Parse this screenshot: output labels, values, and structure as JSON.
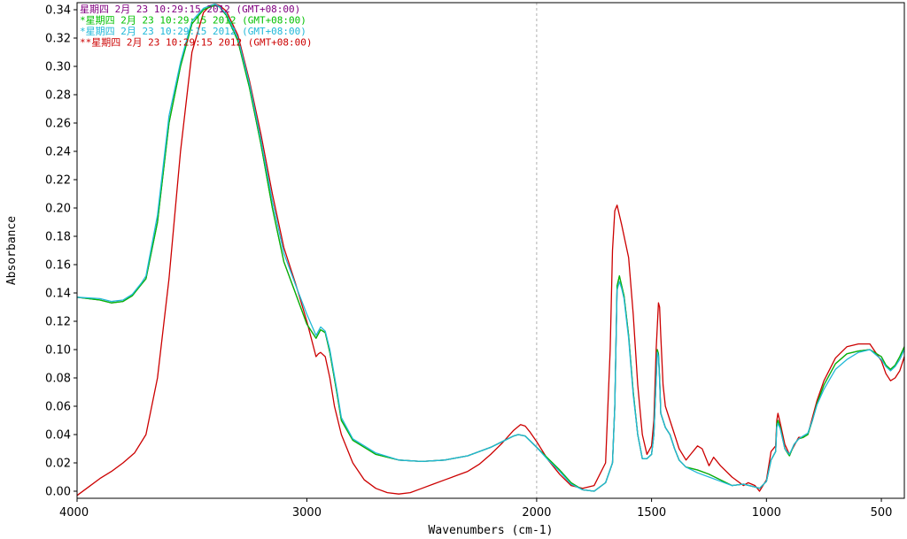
{
  "chart_data": {
    "type": "line",
    "xlabel": "Wavenumbers (cm-1)",
    "ylabel": "Absorbance",
    "xlim": [
      4000,
      400
    ],
    "ylim": [
      -0.005,
      0.345
    ],
    "x_reversed": true,
    "grid": false,
    "vertical_reference_line": 2000,
    "legend_position": "top-left",
    "x_ticks": [
      4000,
      3000,
      2000,
      1500,
      1000,
      500
    ],
    "y_ticks": [
      0.0,
      0.02,
      0.04,
      0.06,
      0.08,
      0.1,
      0.12,
      0.14,
      0.16,
      0.18,
      0.2,
      0.22,
      0.24,
      0.26,
      0.28,
      0.3,
      0.32,
      0.34
    ],
    "y_tick_labels": [
      "0.00",
      "0.02",
      "0.04",
      "0.06",
      "0.08",
      "0.10",
      "0.12",
      "0.14",
      "0.16",
      "0.18",
      "0.20",
      "0.22",
      "0.24",
      "0.26",
      "0.28",
      "0.30",
      "0.32",
      "0.34"
    ],
    "series": [
      {
        "name": "星期四 2月 23 10:29:15 2012 (GMT+08:00)",
        "color": "#800080",
        "x": [
          4000,
          3900,
          3850,
          3800,
          3760,
          3720,
          3700,
          3650,
          3600,
          3550,
          3500,
          3450,
          3420,
          3400,
          3380,
          3350,
          3300,
          3250,
          3200,
          3150,
          3100,
          3050,
          3000,
          2960,
          2940,
          2920,
          2900,
          2870,
          2850,
          2800,
          2700,
          2600,
          2500,
          2400,
          2300,
          2200,
          2150,
          2100,
          2080,
          2050,
          2000,
          1950,
          1900,
          1850,
          1800,
          1750,
          1700,
          1670,
          1660,
          1650,
          1640,
          1630,
          1620,
          1600,
          1580,
          1560,
          1540,
          1520,
          1500,
          1490,
          1480,
          1475,
          1470,
          1465,
          1460,
          1450,
          1440,
          1420,
          1400,
          1380,
          1350,
          1300,
          1250,
          1200,
          1150,
          1100,
          1050,
          1030,
          1000,
          980,
          960,
          955,
          950,
          940,
          920,
          900,
          880,
          860,
          840,
          820,
          800,
          780,
          750,
          700,
          650,
          600,
          550,
          500,
          480,
          460,
          440,
          420,
          400
        ],
        "y": [
          0.137,
          0.135,
          0.133,
          0.134,
          0.138,
          0.146,
          0.15,
          0.19,
          0.26,
          0.3,
          0.33,
          0.34,
          0.342,
          0.343,
          0.342,
          0.336,
          0.318,
          0.285,
          0.245,
          0.2,
          0.162,
          0.14,
          0.118,
          0.108,
          0.114,
          0.112,
          0.098,
          0.07,
          0.05,
          0.036,
          0.026,
          0.022,
          0.021,
          0.022,
          0.025,
          0.031,
          0.035,
          0.039,
          0.04,
          0.039,
          0.031,
          0.023,
          0.015,
          0.006,
          0.001,
          0.0,
          0.006,
          0.02,
          0.06,
          0.145,
          0.152,
          0.145,
          0.138,
          0.11,
          0.07,
          0.04,
          0.023,
          0.023,
          0.026,
          0.04,
          0.08,
          0.1,
          0.097,
          0.08,
          0.055,
          0.05,
          0.045,
          0.04,
          0.03,
          0.022,
          0.017,
          0.015,
          0.012,
          0.008,
          0.004,
          0.005,
          0.003,
          0.002,
          0.007,
          0.022,
          0.028,
          0.047,
          0.05,
          0.045,
          0.03,
          0.025,
          0.033,
          0.037,
          0.038,
          0.04,
          0.05,
          0.062,
          0.075,
          0.09,
          0.097,
          0.099,
          0.1,
          0.095,
          0.089,
          0.086,
          0.089,
          0.095,
          0.102
        ]
      },
      {
        "name": "*星期四 2月 23 10:29:15 2012 (GMT+08:00)",
        "color": "#00c000",
        "x": [
          4000,
          3900,
          3850,
          3800,
          3760,
          3720,
          3700,
          3650,
          3600,
          3550,
          3500,
          3450,
          3420,
          3400,
          3380,
          3350,
          3300,
          3250,
          3200,
          3150,
          3100,
          3050,
          3000,
          2960,
          2940,
          2920,
          2900,
          2870,
          2850,
          2800,
          2700,
          2600,
          2500,
          2400,
          2300,
          2200,
          2150,
          2100,
          2080,
          2050,
          2000,
          1950,
          1900,
          1850,
          1800,
          1750,
          1700,
          1670,
          1660,
          1650,
          1640,
          1630,
          1620,
          1600,
          1580,
          1560,
          1540,
          1520,
          1500,
          1490,
          1480,
          1475,
          1470,
          1465,
          1460,
          1450,
          1440,
          1420,
          1400,
          1380,
          1350,
          1300,
          1250,
          1200,
          1150,
          1100,
          1050,
          1030,
          1000,
          980,
          960,
          955,
          950,
          940,
          920,
          900,
          880,
          860,
          840,
          820,
          800,
          780,
          750,
          700,
          650,
          600,
          550,
          500,
          480,
          460,
          440,
          420,
          400
        ],
        "y": [
          0.137,
          0.135,
          0.133,
          0.134,
          0.138,
          0.146,
          0.15,
          0.19,
          0.26,
          0.3,
          0.33,
          0.34,
          0.342,
          0.343,
          0.342,
          0.336,
          0.318,
          0.285,
          0.245,
          0.2,
          0.162,
          0.14,
          0.118,
          0.108,
          0.114,
          0.112,
          0.098,
          0.07,
          0.05,
          0.036,
          0.026,
          0.022,
          0.021,
          0.022,
          0.025,
          0.031,
          0.035,
          0.039,
          0.04,
          0.039,
          0.031,
          0.023,
          0.015,
          0.006,
          0.001,
          0.0,
          0.006,
          0.02,
          0.06,
          0.145,
          0.152,
          0.145,
          0.138,
          0.11,
          0.07,
          0.04,
          0.023,
          0.023,
          0.026,
          0.04,
          0.08,
          0.1,
          0.097,
          0.08,
          0.055,
          0.05,
          0.045,
          0.04,
          0.03,
          0.022,
          0.017,
          0.015,
          0.012,
          0.008,
          0.004,
          0.005,
          0.003,
          0.002,
          0.007,
          0.022,
          0.028,
          0.047,
          0.05,
          0.045,
          0.03,
          0.025,
          0.033,
          0.037,
          0.038,
          0.04,
          0.05,
          0.062,
          0.075,
          0.09,
          0.097,
          0.099,
          0.1,
          0.095,
          0.089,
          0.086,
          0.089,
          0.095,
          0.102
        ]
      },
      {
        "name": "*星期四 2月 23 10:29:15 2012 (GMT+08:00)",
        "color": "#20b8d8",
        "x": [
          4000,
          3900,
          3850,
          3800,
          3760,
          3720,
          3700,
          3650,
          3600,
          3550,
          3500,
          3450,
          3420,
          3400,
          3380,
          3350,
          3300,
          3250,
          3200,
          3150,
          3100,
          3050,
          3000,
          2960,
          2940,
          2920,
          2900,
          2870,
          2850,
          2800,
          2700,
          2600,
          2500,
          2400,
          2300,
          2200,
          2150,
          2100,
          2080,
          2050,
          2000,
          1950,
          1900,
          1850,
          1800,
          1750,
          1700,
          1670,
          1660,
          1650,
          1640,
          1630,
          1620,
          1600,
          1580,
          1560,
          1540,
          1520,
          1500,
          1490,
          1480,
          1475,
          1470,
          1465,
          1460,
          1450,
          1440,
          1420,
          1400,
          1380,
          1350,
          1300,
          1250,
          1200,
          1150,
          1100,
          1050,
          1030,
          1000,
          980,
          960,
          955,
          950,
          940,
          920,
          900,
          880,
          860,
          840,
          820,
          800,
          780,
          750,
          700,
          650,
          600,
          550,
          500,
          480,
          460,
          440,
          420,
          400
        ],
        "y": [
          0.137,
          0.136,
          0.134,
          0.135,
          0.139,
          0.147,
          0.152,
          0.195,
          0.265,
          0.303,
          0.332,
          0.341,
          0.343,
          0.344,
          0.342,
          0.337,
          0.32,
          0.288,
          0.248,
          0.205,
          0.168,
          0.146,
          0.125,
          0.11,
          0.116,
          0.113,
          0.1,
          0.072,
          0.052,
          0.037,
          0.027,
          0.022,
          0.021,
          0.022,
          0.025,
          0.031,
          0.035,
          0.039,
          0.04,
          0.039,
          0.031,
          0.022,
          0.014,
          0.005,
          0.001,
          0.0,
          0.006,
          0.02,
          0.06,
          0.142,
          0.148,
          0.143,
          0.136,
          0.108,
          0.068,
          0.04,
          0.023,
          0.023,
          0.026,
          0.04,
          0.078,
          0.098,
          0.095,
          0.078,
          0.055,
          0.05,
          0.045,
          0.04,
          0.03,
          0.022,
          0.017,
          0.013,
          0.01,
          0.007,
          0.004,
          0.005,
          0.003,
          0.002,
          0.007,
          0.022,
          0.028,
          0.045,
          0.048,
          0.044,
          0.03,
          0.026,
          0.033,
          0.037,
          0.039,
          0.041,
          0.05,
          0.061,
          0.072,
          0.086,
          0.093,
          0.098,
          0.1,
          0.093,
          0.088,
          0.085,
          0.088,
          0.093,
          0.1
        ]
      },
      {
        "name": "**星期四 2月 23 10:29:15 2012 (GMT+08:00)",
        "color": "#cc0000",
        "x": [
          4000,
          3950,
          3900,
          3850,
          3800,
          3750,
          3700,
          3650,
          3600,
          3550,
          3500,
          3450,
          3420,
          3400,
          3380,
          3350,
          3300,
          3250,
          3200,
          3150,
          3100,
          3050,
          3000,
          2960,
          2950,
          2940,
          2920,
          2900,
          2880,
          2850,
          2800,
          2750,
          2700,
          2650,
          2600,
          2550,
          2500,
          2450,
          2400,
          2350,
          2300,
          2250,
          2200,
          2150,
          2100,
          2070,
          2050,
          2030,
          2000,
          1950,
          1900,
          1850,
          1800,
          1750,
          1700,
          1680,
          1670,
          1660,
          1650,
          1640,
          1630,
          1600,
          1580,
          1560,
          1540,
          1520,
          1500,
          1490,
          1480,
          1470,
          1465,
          1460,
          1450,
          1440,
          1420,
          1400,
          1380,
          1350,
          1330,
          1300,
          1280,
          1250,
          1230,
          1200,
          1150,
          1100,
          1080,
          1050,
          1030,
          1000,
          980,
          960,
          955,
          950,
          940,
          920,
          900,
          880,
          860,
          840,
          820,
          800,
          780,
          750,
          700,
          650,
          600,
          550,
          500,
          480,
          460,
          440,
          420,
          400
        ],
        "y": [
          -0.003,
          0.003,
          0.009,
          0.014,
          0.02,
          0.027,
          0.04,
          0.08,
          0.15,
          0.24,
          0.31,
          0.338,
          0.343,
          0.344,
          0.343,
          0.339,
          0.322,
          0.29,
          0.252,
          0.21,
          0.172,
          0.147,
          0.12,
          0.095,
          0.097,
          0.098,
          0.095,
          0.08,
          0.06,
          0.04,
          0.02,
          0.008,
          0.002,
          -0.001,
          -0.002,
          -0.001,
          0.002,
          0.005,
          0.008,
          0.011,
          0.014,
          0.019,
          0.026,
          0.034,
          0.043,
          0.047,
          0.046,
          0.042,
          0.035,
          0.022,
          0.012,
          0.004,
          0.002,
          0.004,
          0.02,
          0.1,
          0.17,
          0.198,
          0.202,
          0.195,
          0.188,
          0.165,
          0.125,
          0.075,
          0.04,
          0.026,
          0.032,
          0.05,
          0.1,
          0.133,
          0.13,
          0.11,
          0.075,
          0.06,
          0.05,
          0.04,
          0.03,
          0.022,
          0.026,
          0.032,
          0.03,
          0.018,
          0.024,
          0.018,
          0.01,
          0.004,
          0.006,
          0.004,
          0.0,
          0.008,
          0.028,
          0.032,
          0.05,
          0.055,
          0.048,
          0.033,
          0.026,
          0.032,
          0.038,
          0.038,
          0.04,
          0.052,
          0.064,
          0.078,
          0.094,
          0.102,
          0.104,
          0.104,
          0.092,
          0.083,
          0.078,
          0.08,
          0.085,
          0.095
        ]
      }
    ]
  }
}
